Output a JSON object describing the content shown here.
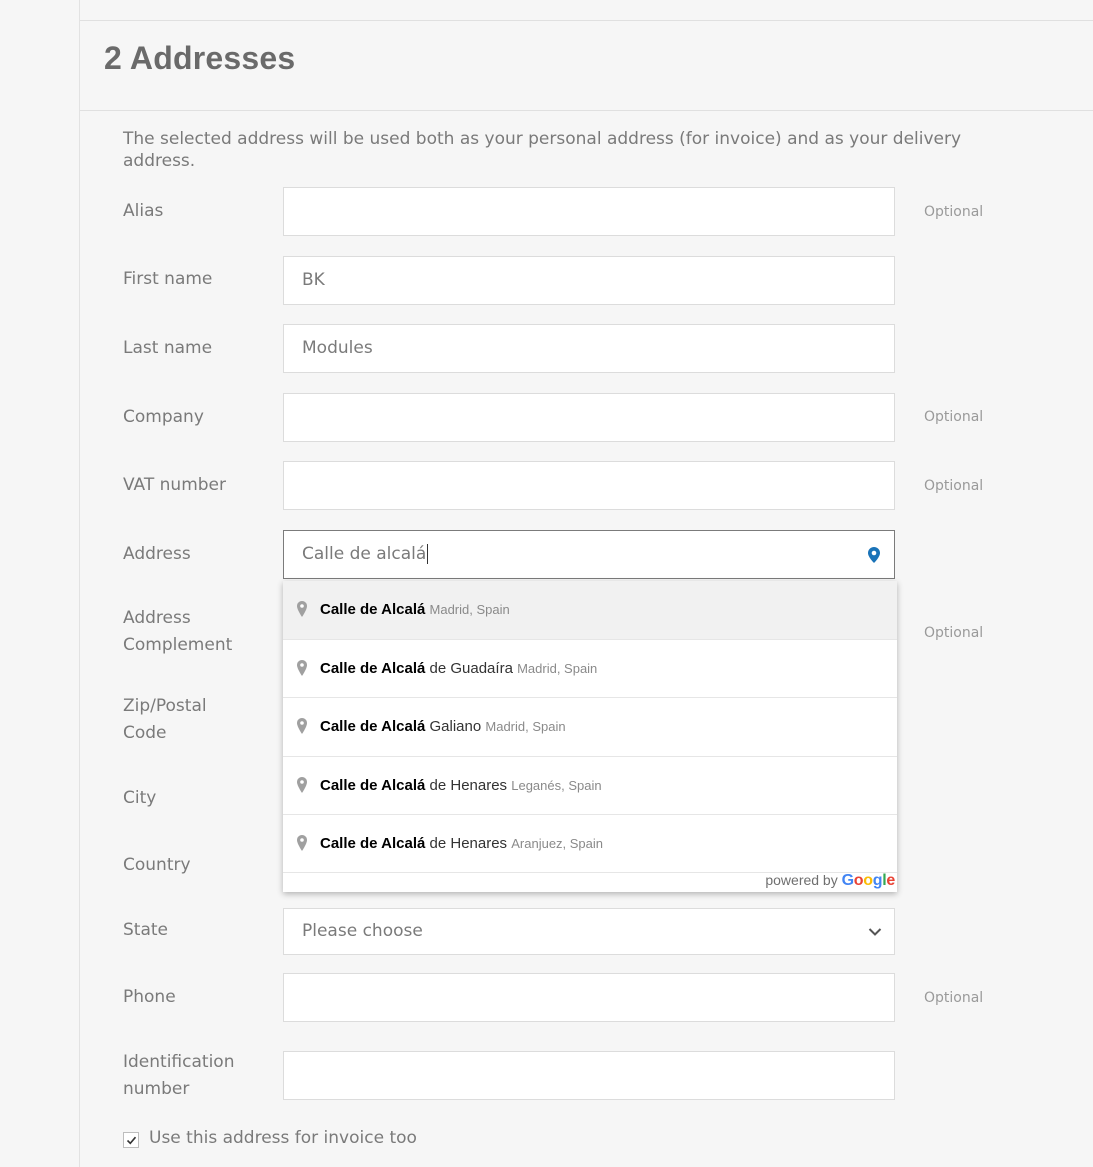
{
  "section": {
    "title": "2 Addresses"
  },
  "intro": "The selected address will be used both as your personal address (for invoice) and as your delivery address.",
  "optional_label": "Optional",
  "fields": {
    "alias": {
      "label": "Alias",
      "value": "",
      "optional": true
    },
    "first_name": {
      "label": "First name",
      "value": "BK"
    },
    "last_name": {
      "label": "Last name",
      "value": "Modules"
    },
    "company": {
      "label": "Company",
      "value": "",
      "optional": true
    },
    "vat": {
      "label": "VAT number",
      "value": "",
      "optional": true
    },
    "address": {
      "label": "Address",
      "value": "Calle de alcalá"
    },
    "address_complement": {
      "label_line1": "Address",
      "label_line2": "Complement",
      "optional": true
    },
    "zip": {
      "label_line1": "Zip/Postal",
      "label_line2": "Code"
    },
    "city": {
      "label": "City"
    },
    "country": {
      "label": "Country"
    },
    "state": {
      "label": "State",
      "value": "Please choose"
    },
    "phone": {
      "label": "Phone",
      "value": "",
      "optional": true
    },
    "identification": {
      "label_line1": "Identification",
      "label_line2": "number",
      "value": ""
    }
  },
  "autocomplete": {
    "items": [
      {
        "main": "Calle de Alcalá",
        "rest": "",
        "secondary": "Madrid, Spain"
      },
      {
        "main": "Calle de Alcalá",
        "rest": " de Guadaíra",
        "secondary": "Madrid, Spain"
      },
      {
        "main": "Calle de Alcalá",
        "rest": " Galiano",
        "secondary": "Madrid, Spain"
      },
      {
        "main": "Calle de Alcalá",
        "rest": " de Henares",
        "secondary": "Leganés, Spain"
      },
      {
        "main": "Calle de Alcalá",
        "rest": " de Henares",
        "secondary": "Aranjuez, Spain"
      }
    ],
    "powered_by": "powered by",
    "google": {
      "letters": [
        "G",
        "o",
        "o",
        "g",
        "l",
        "e"
      ],
      "colors": [
        "#4285F4",
        "#EA4335",
        "#FBBC05",
        "#4285F4",
        "#34A853",
        "#EA4335"
      ]
    }
  },
  "checkbox": {
    "label": "Use this address for invoice too",
    "checked": true
  },
  "colors": {
    "pin_accent": "#1a73b8",
    "pin_gray": "#a0a0a0"
  }
}
